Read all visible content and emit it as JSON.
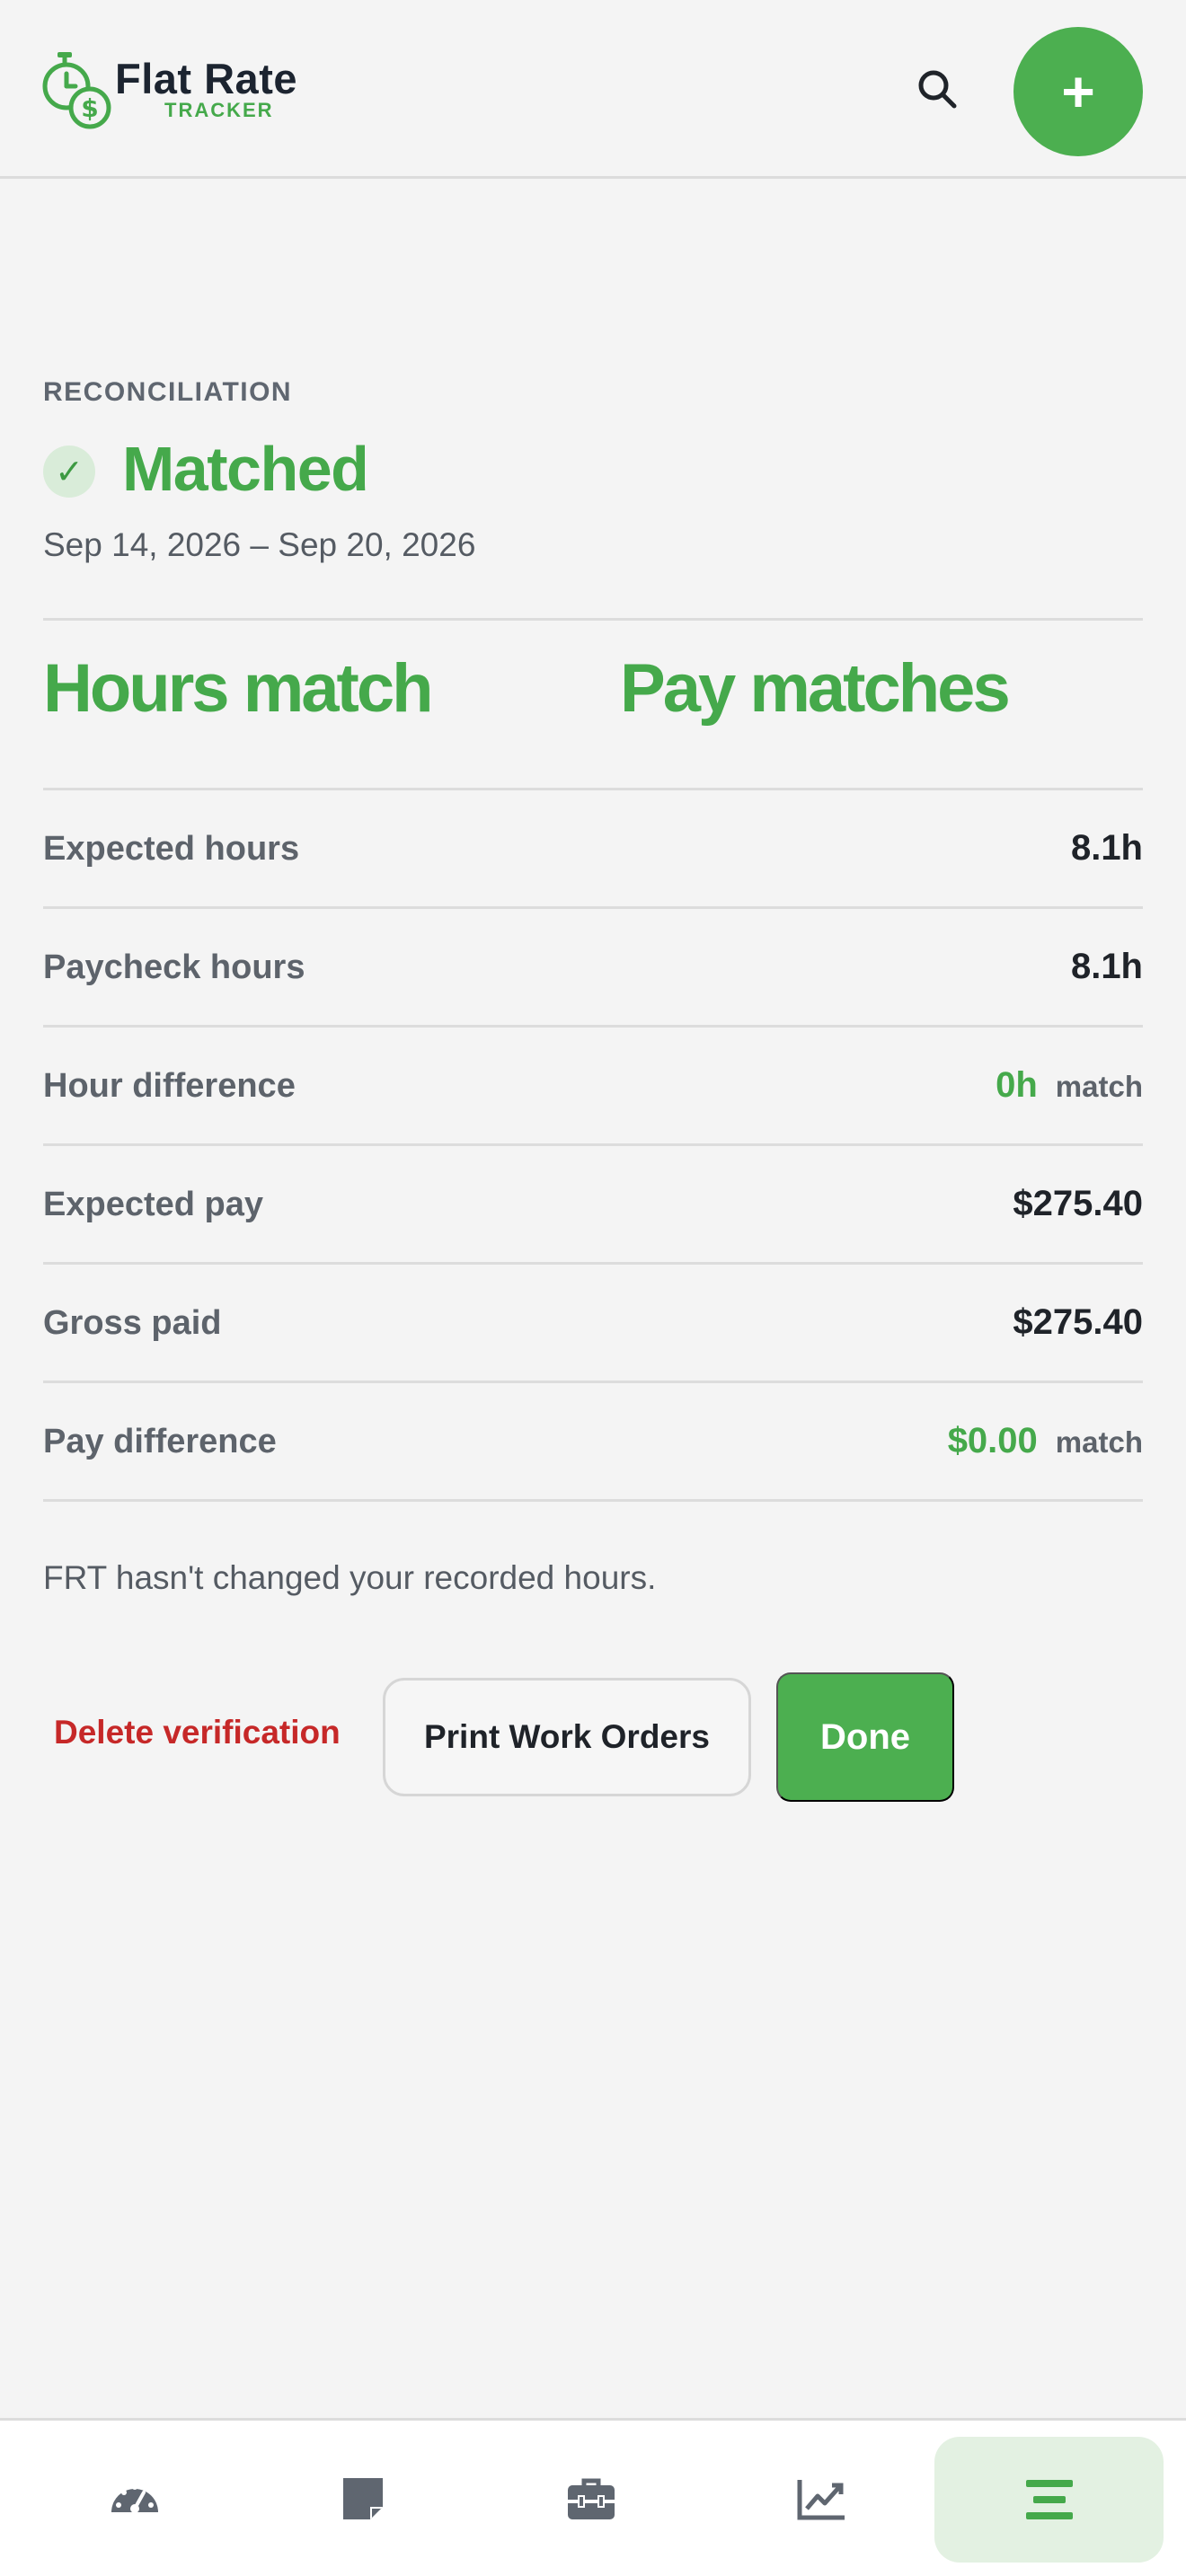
{
  "header": {
    "app_name": "Flat Rate",
    "app_subtitle": "TRACKER",
    "add_label": "+"
  },
  "reconciliation": {
    "eyebrow": "RECONCILIATION",
    "status": "Matched",
    "check_glyph": "✓",
    "date_range": "Sep 14, 2026 – Sep 20, 2026",
    "hours_summary": "Hours match",
    "pay_summary": "Pay matches"
  },
  "rows": [
    {
      "label": "Expected hours",
      "value": "8.1h"
    },
    {
      "label": "Paycheck hours",
      "value": "8.1h"
    },
    {
      "label": "Hour difference",
      "value": "0h",
      "tag": "match"
    },
    {
      "label": "Expected pay",
      "value": "$275.40"
    },
    {
      "label": "Gross paid",
      "value": "$275.40"
    },
    {
      "label": "Pay difference",
      "value": "$0.00",
      "tag": "match"
    }
  ],
  "note": "FRT hasn't changed your recorded hours.",
  "actions": {
    "delete_label": "Delete verification",
    "print_label": "Print Work Orders",
    "done_label": "Done"
  },
  "nav": {
    "items": [
      {
        "icon": "dashboard-gauge-icon",
        "active": false
      },
      {
        "icon": "notes-icon",
        "active": false
      },
      {
        "icon": "toolbox-icon",
        "active": false
      },
      {
        "icon": "chart-line-icon",
        "active": false
      },
      {
        "icon": "menu-icon",
        "active": true
      }
    ]
  },
  "colors": {
    "accent": "#4caf50",
    "accent_text": "#45a94b",
    "danger": "#c62828",
    "muted": "#5d636b",
    "background": "#f4f4f4"
  }
}
